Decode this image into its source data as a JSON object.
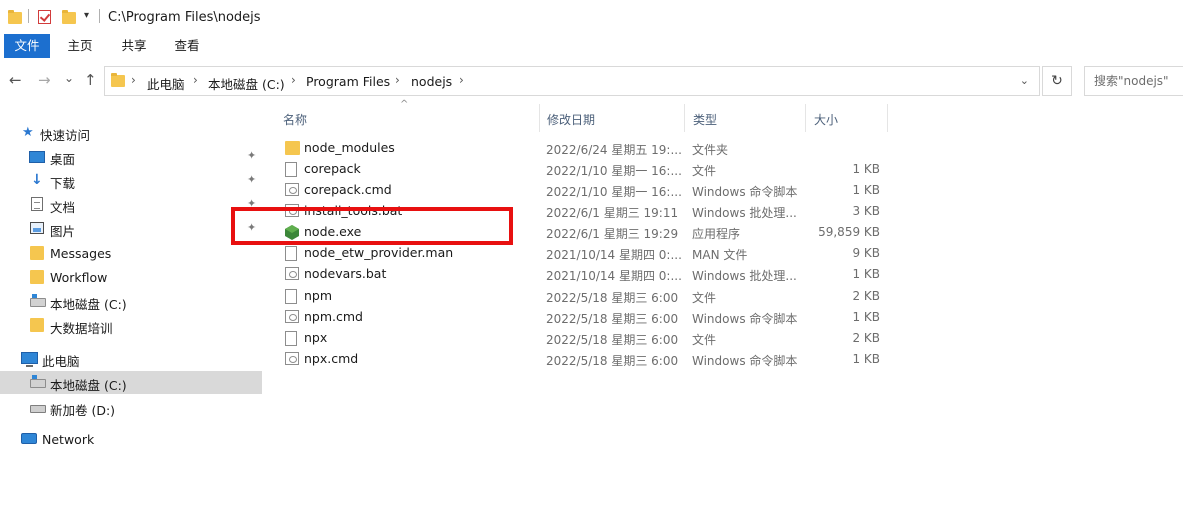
{
  "window": {
    "title_path": "C:\\Program Files\\nodejs",
    "qa_dropdown": "▾"
  },
  "ribbon": {
    "tabs": [
      {
        "label": "文件",
        "active": true
      },
      {
        "label": "主页",
        "active": false
      },
      {
        "label": "共享",
        "active": false
      },
      {
        "label": "查看",
        "active": false
      }
    ]
  },
  "nav": {
    "back": "←",
    "forward": "→",
    "recent": "⌄",
    "up": "↑",
    "breadcrumbs": [
      "此电脑",
      "本地磁盘 (C:)",
      "Program Files",
      "nodejs"
    ],
    "crumb_sep": "›",
    "dropdown": "⌄",
    "refresh": "↻",
    "search_placeholder": "搜索\"nodejs\""
  },
  "sidebar": {
    "items": [
      {
        "label": "快速访问",
        "icon": "star-icon",
        "pinned": false,
        "level": 0
      },
      {
        "label": "桌面",
        "icon": "desktop-icon",
        "pinned": true,
        "level": 1
      },
      {
        "label": "下载",
        "icon": "download-icon",
        "pinned": true,
        "level": 1
      },
      {
        "label": "文档",
        "icon": "document-icon",
        "pinned": true,
        "level": 1
      },
      {
        "label": "图片",
        "icon": "picture-icon",
        "pinned": true,
        "level": 1
      },
      {
        "label": "Messages",
        "icon": "folder-icon",
        "pinned": false,
        "level": 1
      },
      {
        "label": "Workflow",
        "icon": "folder-icon",
        "pinned": false,
        "level": 1
      },
      {
        "label": "本地磁盘 (C:)",
        "icon": "drive-icon",
        "pinned": false,
        "level": 1
      },
      {
        "label": "大数据培训",
        "icon": "folder-icon",
        "pinned": false,
        "level": 1
      },
      {
        "label": "此电脑",
        "icon": "pc-icon",
        "pinned": false,
        "level": 0
      },
      {
        "label": "本地磁盘 (C:)",
        "icon": "drive-icon",
        "pinned": false,
        "level": 1,
        "selected": true
      },
      {
        "label": "新加卷 (D:)",
        "icon": "drive-icon",
        "pinned": false,
        "level": 1
      },
      {
        "label": "Network",
        "icon": "network-icon",
        "pinned": false,
        "level": 0
      }
    ],
    "pin_glyph": "📌"
  },
  "columns": {
    "name": "名称",
    "date": "修改日期",
    "type": "类型",
    "size": "大小",
    "sort_glyph": "^"
  },
  "files": [
    {
      "name": "node_modules",
      "date": "2022/6/24 星期五 19:...",
      "type": "文件夹",
      "size": "",
      "icon": "folder-icon"
    },
    {
      "name": "corepack",
      "date": "2022/1/10 星期一 16:...",
      "type": "文件",
      "size": "1 KB",
      "icon": "file-icon"
    },
    {
      "name": "corepack.cmd",
      "date": "2022/1/10 星期一 16:...",
      "type": "Windows 命令脚本",
      "size": "1 KB",
      "icon": "script-icon"
    },
    {
      "name": "install_tools.bat",
      "date": "2022/6/1 星期三 19:11",
      "type": "Windows 批处理...",
      "size": "3 KB",
      "icon": "script-icon"
    },
    {
      "name": "node.exe",
      "date": "2022/6/1 星期三 19:29",
      "type": "应用程序",
      "size": "59,859 KB",
      "icon": "node-icon"
    },
    {
      "name": "node_etw_provider.man",
      "date": "2021/10/14 星期四 0:...",
      "type": "MAN 文件",
      "size": "9 KB",
      "icon": "file-icon"
    },
    {
      "name": "nodevars.bat",
      "date": "2021/10/14 星期四 0:...",
      "type": "Windows 批处理...",
      "size": "1 KB",
      "icon": "script-icon"
    },
    {
      "name": "npm",
      "date": "2022/5/18 星期三 6:00",
      "type": "文件",
      "size": "2 KB",
      "icon": "file-icon"
    },
    {
      "name": "npm.cmd",
      "date": "2022/5/18 星期三 6:00",
      "type": "Windows 命令脚本",
      "size": "1 KB",
      "icon": "script-icon"
    },
    {
      "name": "npx",
      "date": "2022/5/18 星期三 6:00",
      "type": "文件",
      "size": "2 KB",
      "icon": "file-icon"
    },
    {
      "name": "npx.cmd",
      "date": "2022/5/18 星期三 6:00",
      "type": "Windows 命令脚本",
      "size": "1 KB",
      "icon": "script-icon"
    }
  ],
  "colors": {
    "accent": "#1c6fcf",
    "highlight_box": "#e81010",
    "folder": "#f5c64f",
    "node_green": "#3c873a"
  }
}
